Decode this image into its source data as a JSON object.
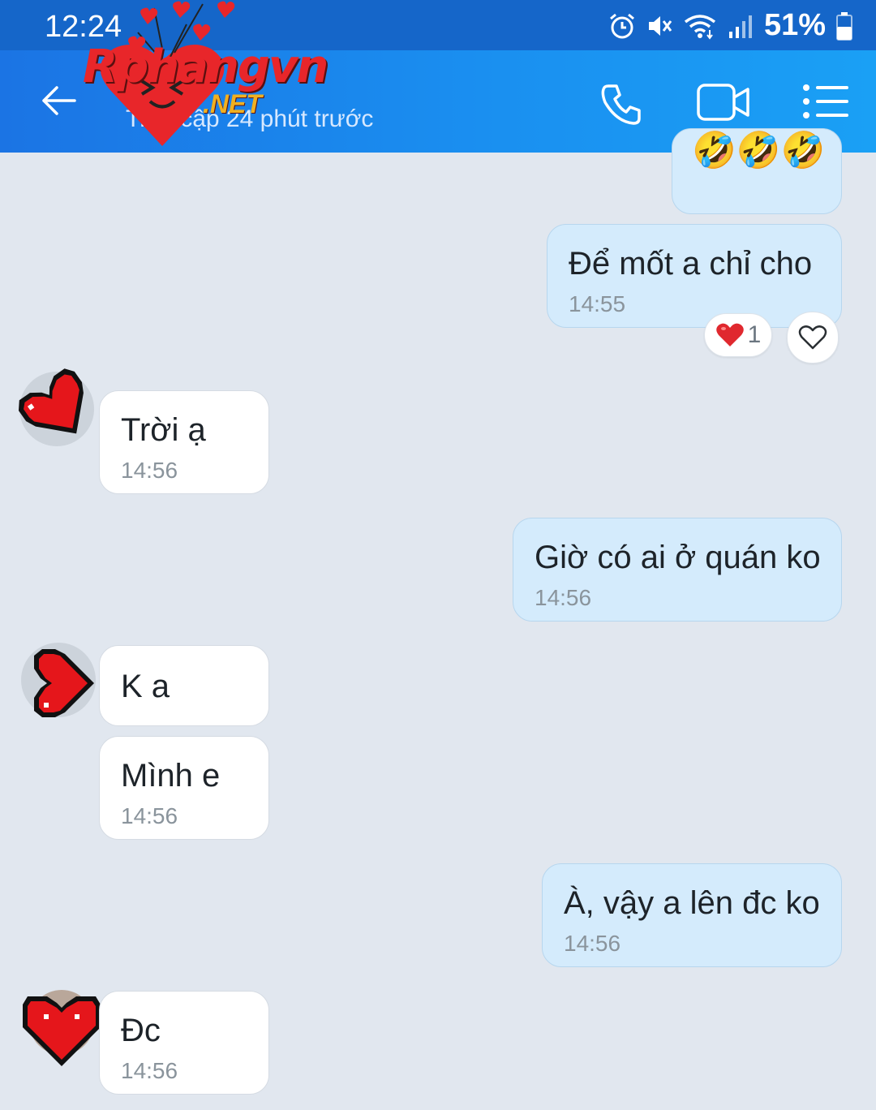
{
  "status_bar": {
    "time": "12:24",
    "battery_percent": "51%",
    "icons": [
      "alarm-icon",
      "mute-icon",
      "wifi-icon",
      "signal-icon",
      "battery-icon"
    ]
  },
  "header": {
    "watermark_text": "Rphangvn",
    "watermark_net": ".NET",
    "last_seen": "Truy cập 24 phút trước",
    "icons": [
      "back-arrow-icon",
      "phone-icon",
      "video-call-icon",
      "menu-list-icon"
    ]
  },
  "messages": [
    {
      "direction": "out",
      "text": "🤣🤣🤣",
      "time": ""
    },
    {
      "direction": "out",
      "text": "Để mốt a chỉ cho",
      "time": "14:55",
      "reaction": {
        "emoji": "❤️",
        "count": "1"
      }
    },
    {
      "direction": "in",
      "text": "Trời ạ",
      "time": "14:56"
    },
    {
      "direction": "out",
      "text": "Giờ có ai ở quán ko",
      "time": "14:56"
    },
    {
      "direction": "in",
      "text": "K a",
      "time": ""
    },
    {
      "direction": "in",
      "text": "Mình e",
      "time": "14:56"
    },
    {
      "direction": "out",
      "text": "À, vậy a lên đc ko",
      "time": "14:56"
    },
    {
      "direction": "in",
      "text": "Đc",
      "time": "14:56"
    }
  ],
  "colors": {
    "header_bg": "#1a8ff0",
    "chat_bg": "#e1e7ef",
    "outgoing_bubble": "#d4ebfc",
    "incoming_bubble": "#ffffff",
    "heart_red": "#e8262a"
  }
}
